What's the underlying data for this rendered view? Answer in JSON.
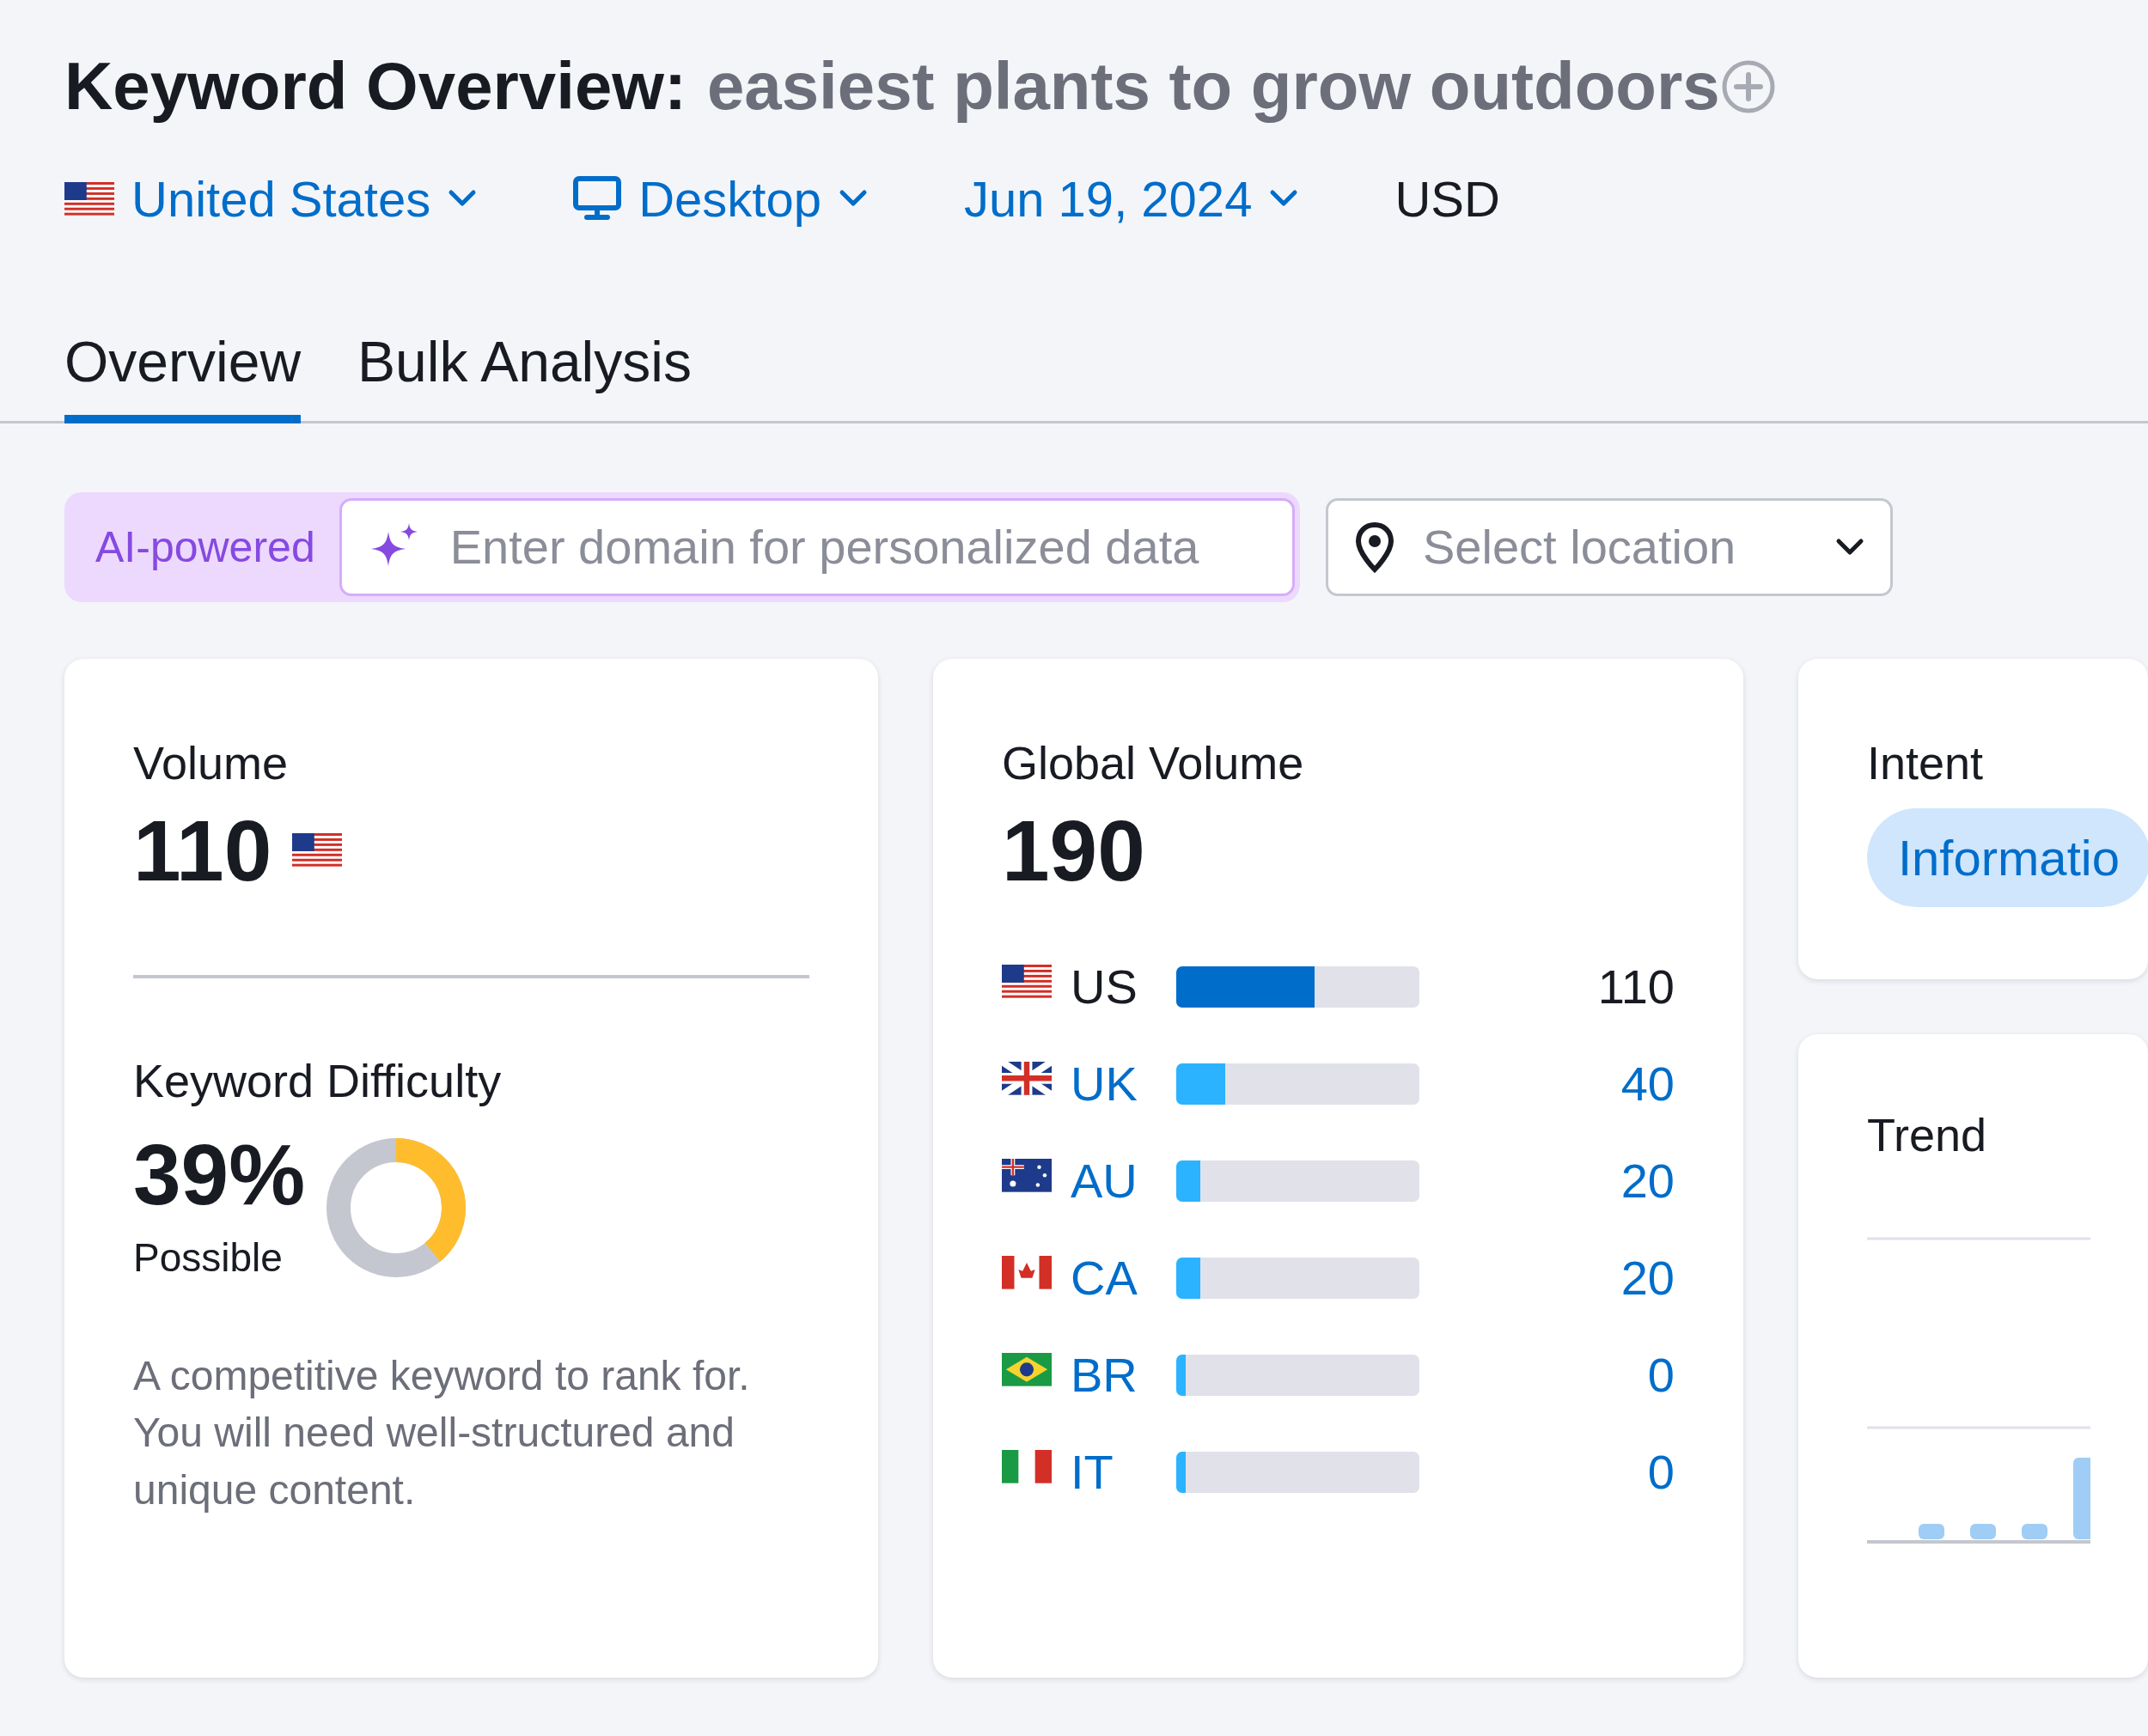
{
  "header": {
    "title": "Keyword Overview:",
    "keyword": "easiest plants to grow outdoors"
  },
  "selectors": [
    {
      "kind": "country",
      "label": "United States"
    },
    {
      "kind": "device",
      "label": "Desktop"
    },
    {
      "kind": "date",
      "label": "Jun 19, 2024"
    },
    {
      "kind": "currency",
      "label": "USD"
    }
  ],
  "tabs": [
    {
      "label": "Overview",
      "selected": true
    },
    {
      "label": "Bulk Analysis",
      "selected": false
    }
  ],
  "search": {
    "badge": "AI-powered",
    "placeholder": "Enter domain for personalized data",
    "location_placeholder": "Select location"
  },
  "volume": {
    "label": "Volume",
    "value": "110"
  },
  "keyword_difficulty": {
    "label": "Keyword Difficulty",
    "value": "39%",
    "rating": "Possible",
    "level": 0.39,
    "description": "A competitive keyword to rank for. You will need well-structured and unique content."
  },
  "global_volume": {
    "label": "Global Volume",
    "value": "190",
    "countries": [
      {
        "code": "US",
        "value": "110",
        "level": 0.57,
        "selected": true
      },
      {
        "code": "UK",
        "value": "40",
        "level": 0.2,
        "selected": false
      },
      {
        "code": "AU",
        "value": "20",
        "level": 0.1,
        "selected": false
      },
      {
        "code": "CA",
        "value": "20",
        "level": 0.1,
        "selected": false
      },
      {
        "code": "BR",
        "value": "0",
        "level": 0.04,
        "selected": false
      },
      {
        "code": "IT",
        "value": "0",
        "level": 0.04,
        "selected": false
      }
    ]
  },
  "intent": {
    "label": "Intent",
    "tag": "Informatio"
  },
  "trend": {
    "label": "Trend"
  }
}
